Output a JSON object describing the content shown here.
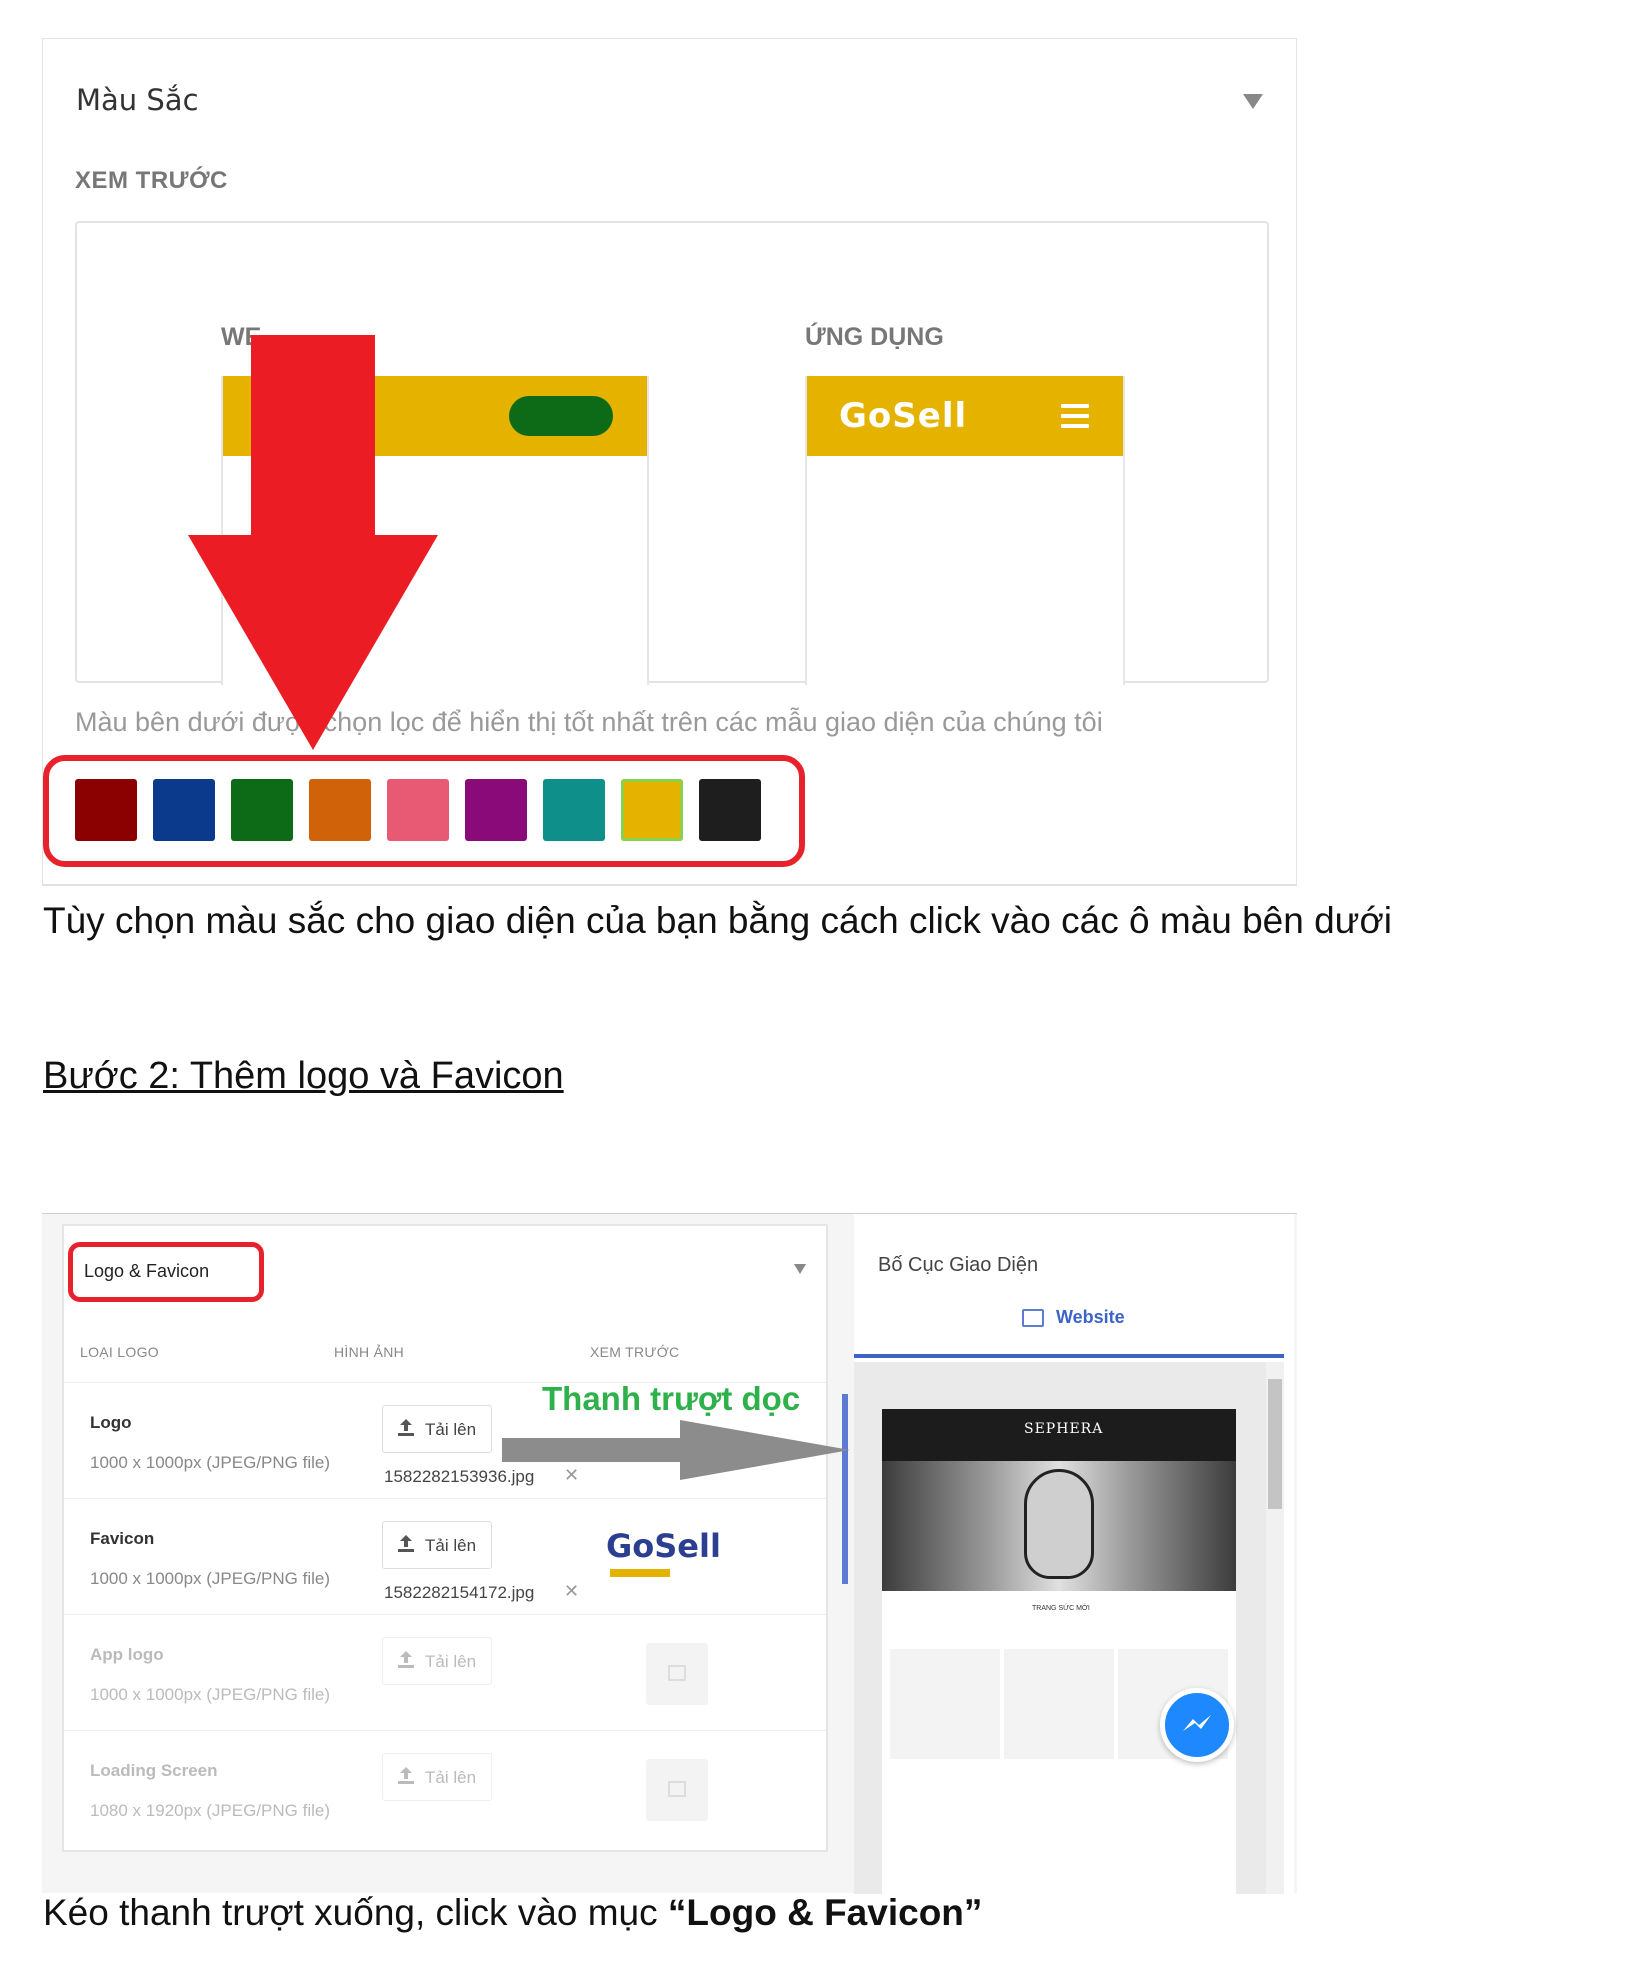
{
  "colors_panel": {
    "title": "Màu Sắc",
    "preview_label": "XEM TRƯỚC",
    "web_label": "WE",
    "app_label": "ỨNG DỤNG",
    "app_logo": "GoSell",
    "hint": "Màu bên dưới được chọn lọc để hiển thị tốt nhất trên các mẫu giao diện của chúng tôi",
    "swatches": [
      "#8B0000",
      "#0B3A8C",
      "#0D6A16",
      "#D0620A",
      "#E85A73",
      "#8B0A7A",
      "#0E8F8A",
      "#E5B200",
      "#1E1E1E"
    ],
    "selected_swatch": "#E5B200"
  },
  "caption_1": "Tùy chọn màu sắc cho giao diện của bạn bằng cách click vào các ô màu bên dưới",
  "step_2_heading": "Bước 2:  Thêm logo và Favicon ",
  "logo_panel": {
    "title": "Logo & Favicon",
    "columns": [
      "LOẠI LOGO",
      "HÌNH ẢNH",
      "XEM TRƯỚC"
    ],
    "rows": [
      {
        "name": "Logo",
        "spec": "1000 x 1000px (JPEG/PNG file)",
        "button": "Tải lên",
        "file": "1582282153936.jpg"
      },
      {
        "name": "Favicon",
        "spec": "1000 x 1000px (JPEG/PNG file)",
        "button": "Tải lên",
        "file": "1582282154172.jpg"
      },
      {
        "name": "App logo",
        "spec": "1000 x 1000px (JPEG/PNG file)",
        "button": "Tải lên"
      },
      {
        "name": "Loading Screen",
        "spec": "1080 x 1920px (JPEG/PNG file)",
        "button": "Tải lên"
      }
    ],
    "favicon_preview": "GoSell"
  },
  "annotation": "Thanh trượt dọc",
  "layout_panel": {
    "title": "Bố Cục Giao Diện",
    "tab": "Website",
    "site_brand": "SEPHERA",
    "site_sub": "TRANG SỨC MỚI"
  },
  "caption_2_prefix": "Kéo thanh trượt xuống, click vào mục ",
  "caption_2_bold": "“Logo & Favicon”"
}
